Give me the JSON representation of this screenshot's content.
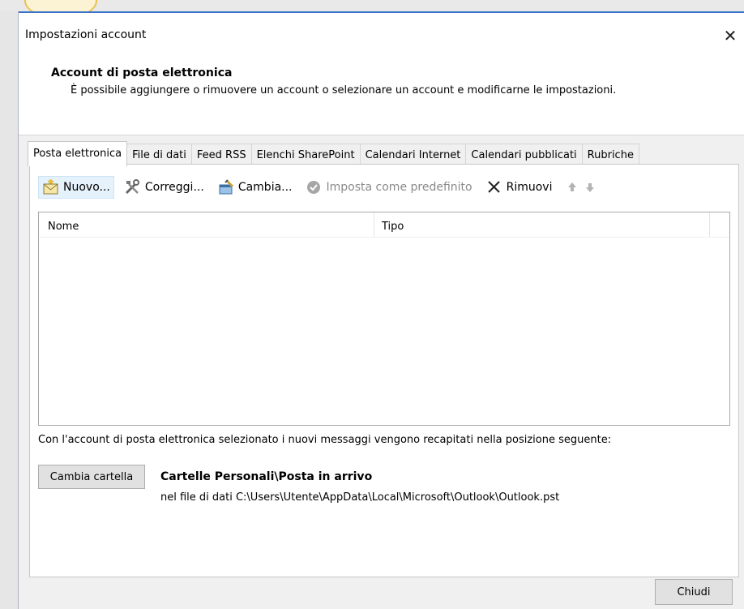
{
  "window": {
    "title": "Impostazioni account",
    "close_glyph": "✕"
  },
  "header": {
    "title": "Account di posta elettronica",
    "subtitle": "È possibile aggiungere o rimuovere un account o selezionare un account e modificarne le impostazioni."
  },
  "tabs": [
    {
      "label": "Posta elettronica",
      "active": true
    },
    {
      "label": "File di dati"
    },
    {
      "label": "Feed RSS"
    },
    {
      "label": "Elenchi SharePoint"
    },
    {
      "label": "Calendari Internet"
    },
    {
      "label": "Calendari pubblicati"
    },
    {
      "label": "Rubriche"
    }
  ],
  "toolbar": {
    "new_label": "Nuovo...",
    "repair_label": "Correggi...",
    "change_label": "Cambia...",
    "set_default_label": "Imposta come predefinito",
    "remove_label": "Rimuovi",
    "icons": [
      "new-mail-icon",
      "repair-tools-icon",
      "change-settings-icon",
      "check-circle-icon",
      "x-icon",
      "arrow-up-icon",
      "arrow-down-icon"
    ]
  },
  "account_list": {
    "columns": [
      "Nome",
      "Tipo"
    ],
    "rows": []
  },
  "delivery": {
    "text": "Con l'account di posta elettronica selezionato i nuovi messaggi vengono recapitati nella posizione seguente:",
    "change_folder_label": "Cambia cartella",
    "folder_name": "Cartelle Personali\\Posta in arrivo",
    "folder_path": "nel file di dati C:\\Users\\Utente\\AppData\\Local\\Microsoft\\Outlook\\Outlook.pst"
  },
  "footer": {
    "close_label": "Chiudi"
  }
}
